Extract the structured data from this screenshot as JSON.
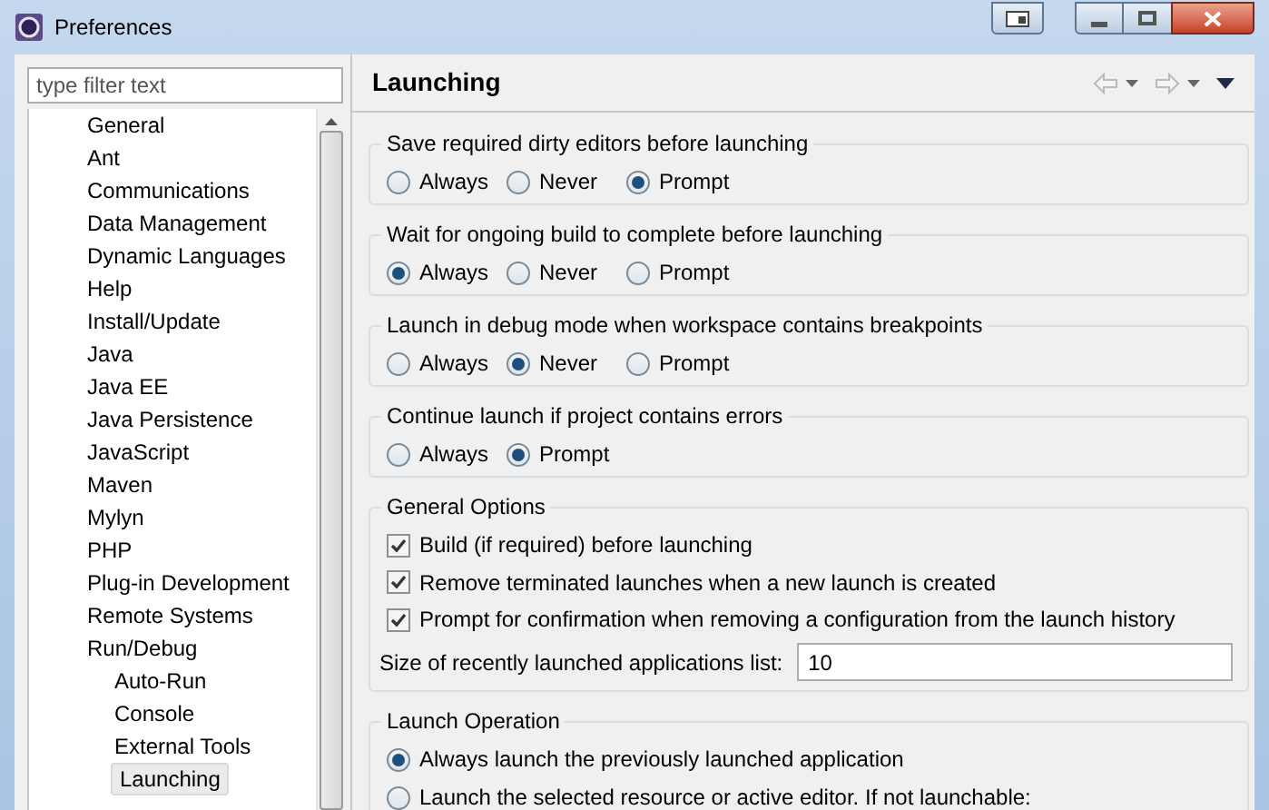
{
  "window": {
    "title": "Preferences"
  },
  "filter": {
    "placeholder": "type filter text"
  },
  "tree": [
    {
      "label": "General",
      "selected": false
    },
    {
      "label": "Ant",
      "selected": false
    },
    {
      "label": "Communications",
      "selected": false
    },
    {
      "label": "Data Management",
      "selected": false
    },
    {
      "label": "Dynamic Languages",
      "selected": false
    },
    {
      "label": "Help",
      "selected": false
    },
    {
      "label": "Install/Update",
      "selected": false
    },
    {
      "label": "Java",
      "selected": false
    },
    {
      "label": "Java EE",
      "selected": false
    },
    {
      "label": "Java Persistence",
      "selected": false
    },
    {
      "label": "JavaScript",
      "selected": false
    },
    {
      "label": "Maven",
      "selected": false
    },
    {
      "label": "Mylyn",
      "selected": false
    },
    {
      "label": "PHP",
      "selected": false
    },
    {
      "label": "Plug-in Development",
      "selected": false
    },
    {
      "label": "Remote Systems",
      "selected": false
    },
    {
      "label": "Run/Debug",
      "selected": false,
      "children": [
        {
          "label": "Auto-Run",
          "selected": false
        },
        {
          "label": "Console",
          "selected": false
        },
        {
          "label": "External Tools",
          "selected": false
        },
        {
          "label": "Launching",
          "selected": true
        }
      ]
    }
  ],
  "page": {
    "title": "Launching"
  },
  "groups": [
    {
      "title": "Save required dirty editors before launching",
      "kind": "radio_row",
      "options": [
        {
          "label": "Always",
          "selected": false
        },
        {
          "label": "Never",
          "selected": false
        },
        {
          "label": "Prompt",
          "selected": true
        }
      ]
    },
    {
      "title": "Wait for ongoing build to complete before launching",
      "kind": "radio_row",
      "options": [
        {
          "label": "Always",
          "selected": true
        },
        {
          "label": "Never",
          "selected": false
        },
        {
          "label": "Prompt",
          "selected": false
        }
      ]
    },
    {
      "title": "Launch in debug mode when workspace contains breakpoints",
      "kind": "radio_row",
      "options": [
        {
          "label": "Always",
          "selected": false
        },
        {
          "label": "Never",
          "selected": true
        },
        {
          "label": "Prompt",
          "selected": false
        }
      ]
    },
    {
      "title": "Continue launch if project contains errors",
      "kind": "radio_row",
      "options": [
        {
          "label": "Always",
          "selected": false
        },
        {
          "label": "Prompt",
          "selected": true
        }
      ]
    },
    {
      "title": "General Options",
      "kind": "options",
      "checks": [
        {
          "label": "Build (if required) before launching",
          "checked": true
        },
        {
          "label": "Remove terminated launches when a new launch is created",
          "checked": true
        },
        {
          "label": "Prompt for confirmation when removing a configuration from the launch history",
          "checked": true
        }
      ],
      "field": {
        "label": "Size of recently launched applications list:",
        "value": "10"
      }
    },
    {
      "title": "Launch Operation",
      "kind": "radio_column",
      "options": [
        {
          "label": "Always launch the previously launched application",
          "selected": true
        },
        {
          "label": "Launch the selected resource or active editor. If not launchable:",
          "selected": false
        }
      ]
    }
  ]
}
